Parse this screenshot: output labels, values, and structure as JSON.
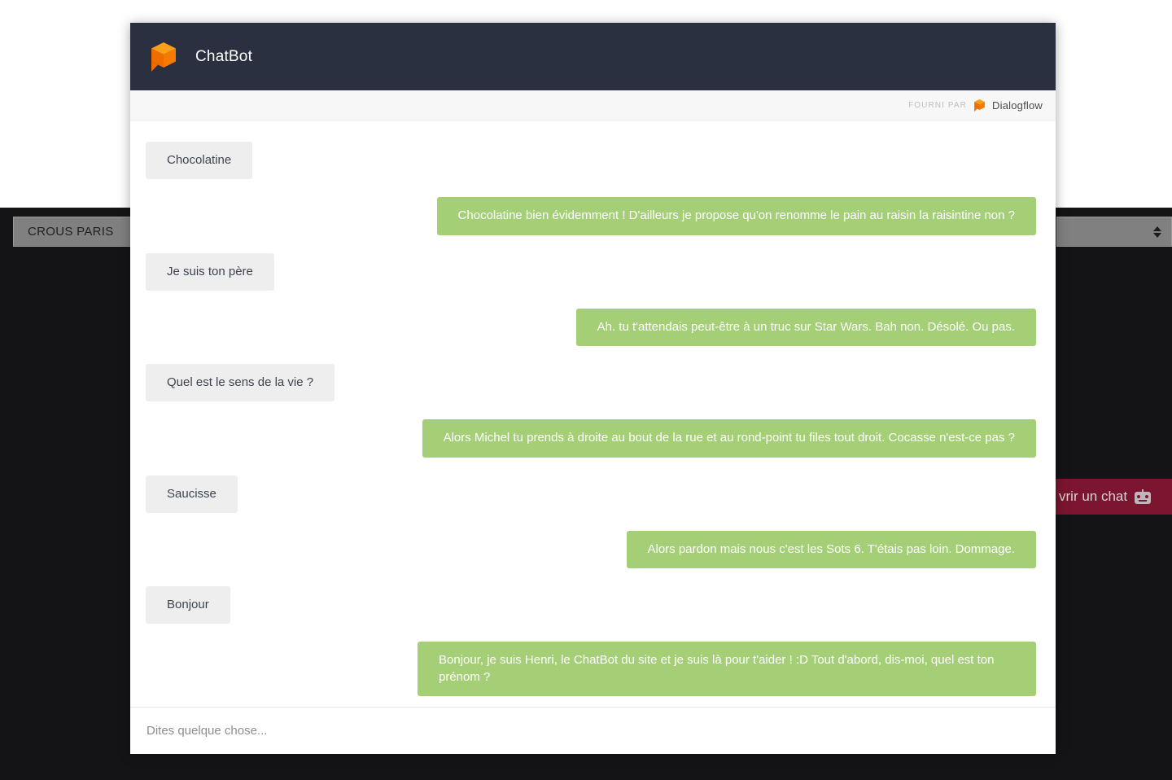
{
  "background": {
    "crous_button_label": "CROUS PARIS",
    "select_value": "",
    "open_chat_label": "vrir un chat",
    "open_chat_icon": "robot-icon",
    "colors": {
      "page_dark": "#141416",
      "open_chat_bg": "#7b1530",
      "control_gray": "#808080"
    }
  },
  "widget": {
    "header": {
      "title": "ChatBot",
      "logo_icon": "dialogflow-cube-icon",
      "background_color": "#2b3040"
    },
    "powered_bar": {
      "label": "FOURNI PAR",
      "brand": "Dialogflow",
      "brand_icon": "dialogflow-cube-icon"
    },
    "input": {
      "placeholder": "Dites quelque chose...",
      "value": ""
    },
    "colors": {
      "user_bubble": "#eeeeee",
      "bot_bubble": "#a5cf76",
      "user_text": "#3d4450",
      "bot_text": "#ffffff"
    },
    "messages": [
      {
        "sender": "user",
        "text": "Chocolatine"
      },
      {
        "sender": "bot",
        "text": "Chocolatine bien évidemment ! D'ailleurs je propose qu'on renomme le pain au raisin la raisintine non ?"
      },
      {
        "sender": "user",
        "text": "Je suis ton père"
      },
      {
        "sender": "bot",
        "text": "Ah. tu t'attendais peut-être à un truc sur Star Wars. Bah non. Désolé. Ou pas."
      },
      {
        "sender": "user",
        "text": "Quel est le sens de la vie ?"
      },
      {
        "sender": "bot",
        "text": "Alors Michel tu prends à droite au bout de la rue et au rond-point tu files tout droit. Cocasse n'est-ce pas ?"
      },
      {
        "sender": "user",
        "text": "Saucisse"
      },
      {
        "sender": "bot",
        "text": "Alors pardon mais nous c'est les Sots 6. T'étais pas loin. Dommage."
      },
      {
        "sender": "user",
        "text": "Bonjour"
      },
      {
        "sender": "bot",
        "text": "Bonjour, je suis Henri, le ChatBot du site et je suis là pour t'aider ! :D Tout d'abord, dis-moi, quel est ton prénom ?"
      }
    ]
  }
}
